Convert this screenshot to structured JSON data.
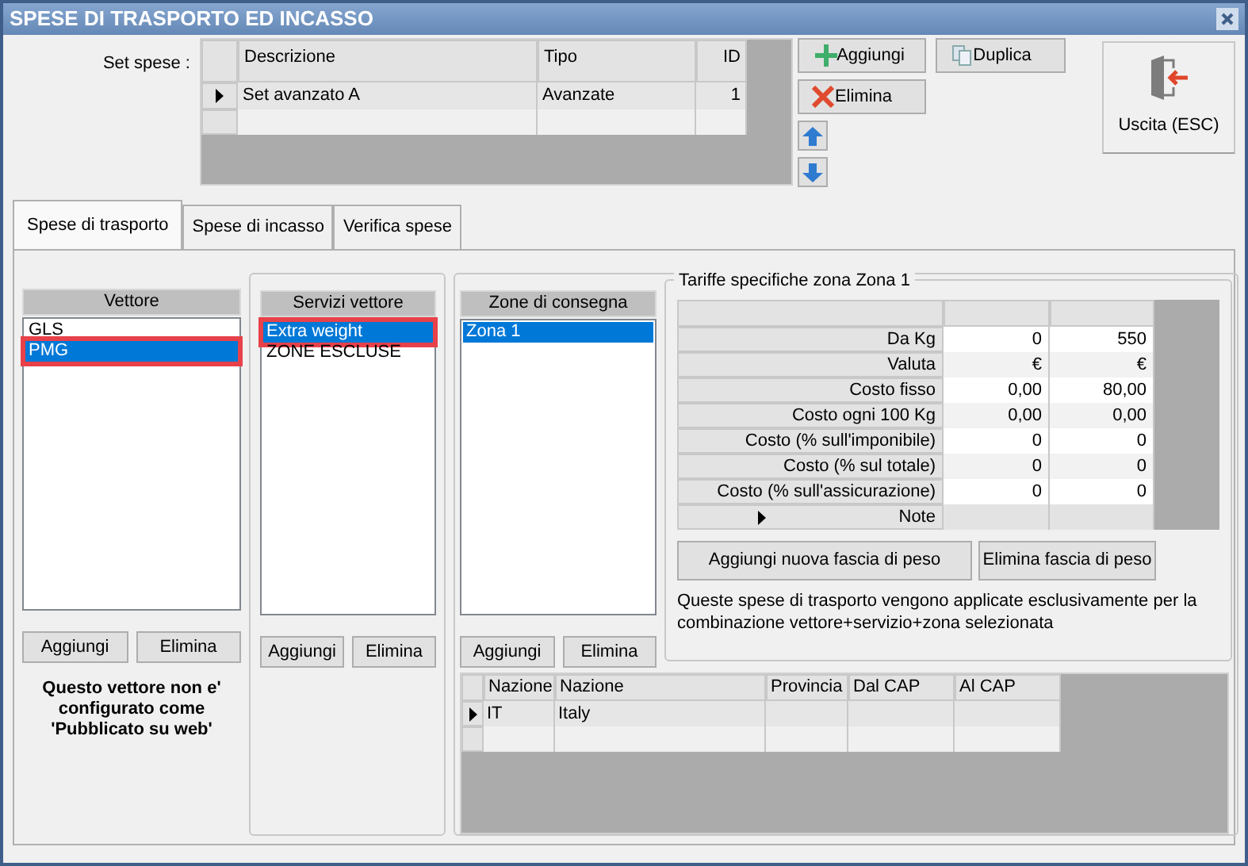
{
  "window": {
    "title": "SPESE DI TRASPORTO ED INCASSO"
  },
  "set_spese": {
    "label": "Set spese :",
    "columns": [
      "Descrizione",
      "Tipo",
      "ID"
    ],
    "rows": [
      {
        "cells": [
          "Set avanzato A",
          "Avanzate",
          "1"
        ],
        "selected": true
      }
    ]
  },
  "toolbar": {
    "add": "Aggiungi",
    "duplicate": "Duplica",
    "delete": "Elimina",
    "exit": "Uscita (ESC)"
  },
  "tabs": [
    {
      "label": "Spese di trasporto",
      "selected": true
    },
    {
      "label": "Spese di incasso",
      "selected": false
    },
    {
      "label": "Verifica spese",
      "selected": false
    }
  ],
  "vettore": {
    "header": "Vettore",
    "items": [
      {
        "label": "GLS",
        "selected": false,
        "highlighted": false
      },
      {
        "label": "PMG",
        "selected": true,
        "highlighted": true
      }
    ],
    "buttons": [
      "Aggiungi",
      "Elimina"
    ],
    "message": "Questo vettore non e' configurato come 'Pubblicato su web'"
  },
  "servizi": {
    "header": "Servizi vettore",
    "items": [
      {
        "label": "Extra weight",
        "selected": true,
        "highlighted": true
      },
      {
        "label": "ZONE ESCLUSE",
        "selected": false,
        "highlighted": false
      }
    ],
    "buttons": [
      "Aggiungi",
      "Elimina"
    ]
  },
  "zone": {
    "header": "Zone di consegna",
    "items": [
      {
        "label": "Zona 1",
        "selected": true,
        "highlighted": false
      }
    ],
    "buttons": [
      "Aggiungi",
      "Elimina"
    ]
  },
  "tariffe": {
    "title": "Tariffe specifiche zona Zona 1",
    "rows": [
      {
        "label": "Da Kg",
        "values": [
          "0",
          "550"
        ],
        "current": false
      },
      {
        "label": "Valuta",
        "values": [
          "€",
          "€"
        ],
        "current": false
      },
      {
        "label": "Costo fisso",
        "values": [
          "0,00",
          "80,00"
        ],
        "current": false
      },
      {
        "label": "Costo ogni 100 Kg",
        "values": [
          "0,00",
          "0,00"
        ],
        "current": false
      },
      {
        "label": "Costo (% sull'imponibile)",
        "values": [
          "0",
          "0"
        ],
        "current": false
      },
      {
        "label": "Costo (% sul totale)",
        "values": [
          "0",
          "0"
        ],
        "current": false
      },
      {
        "label": "Costo (% sull'assicurazione)",
        "values": [
          "0",
          "0"
        ],
        "current": false
      },
      {
        "label": "Note",
        "values": [],
        "current": true
      }
    ],
    "buttons": [
      "Aggiungi nuova fascia di peso",
      "Elimina fascia di peso"
    ],
    "note": "Queste spese di trasporto vengono applicate esclusivamente per la combinazione vettore+servizio+zona selezionata"
  },
  "nazioni": {
    "columns": [
      "Nazione",
      "Nazione",
      "Provincia",
      "Dal CAP",
      "Al CAP"
    ],
    "rows": [
      {
        "cells": [
          "IT",
          "Italy"
        ],
        "selected": true
      }
    ]
  }
}
